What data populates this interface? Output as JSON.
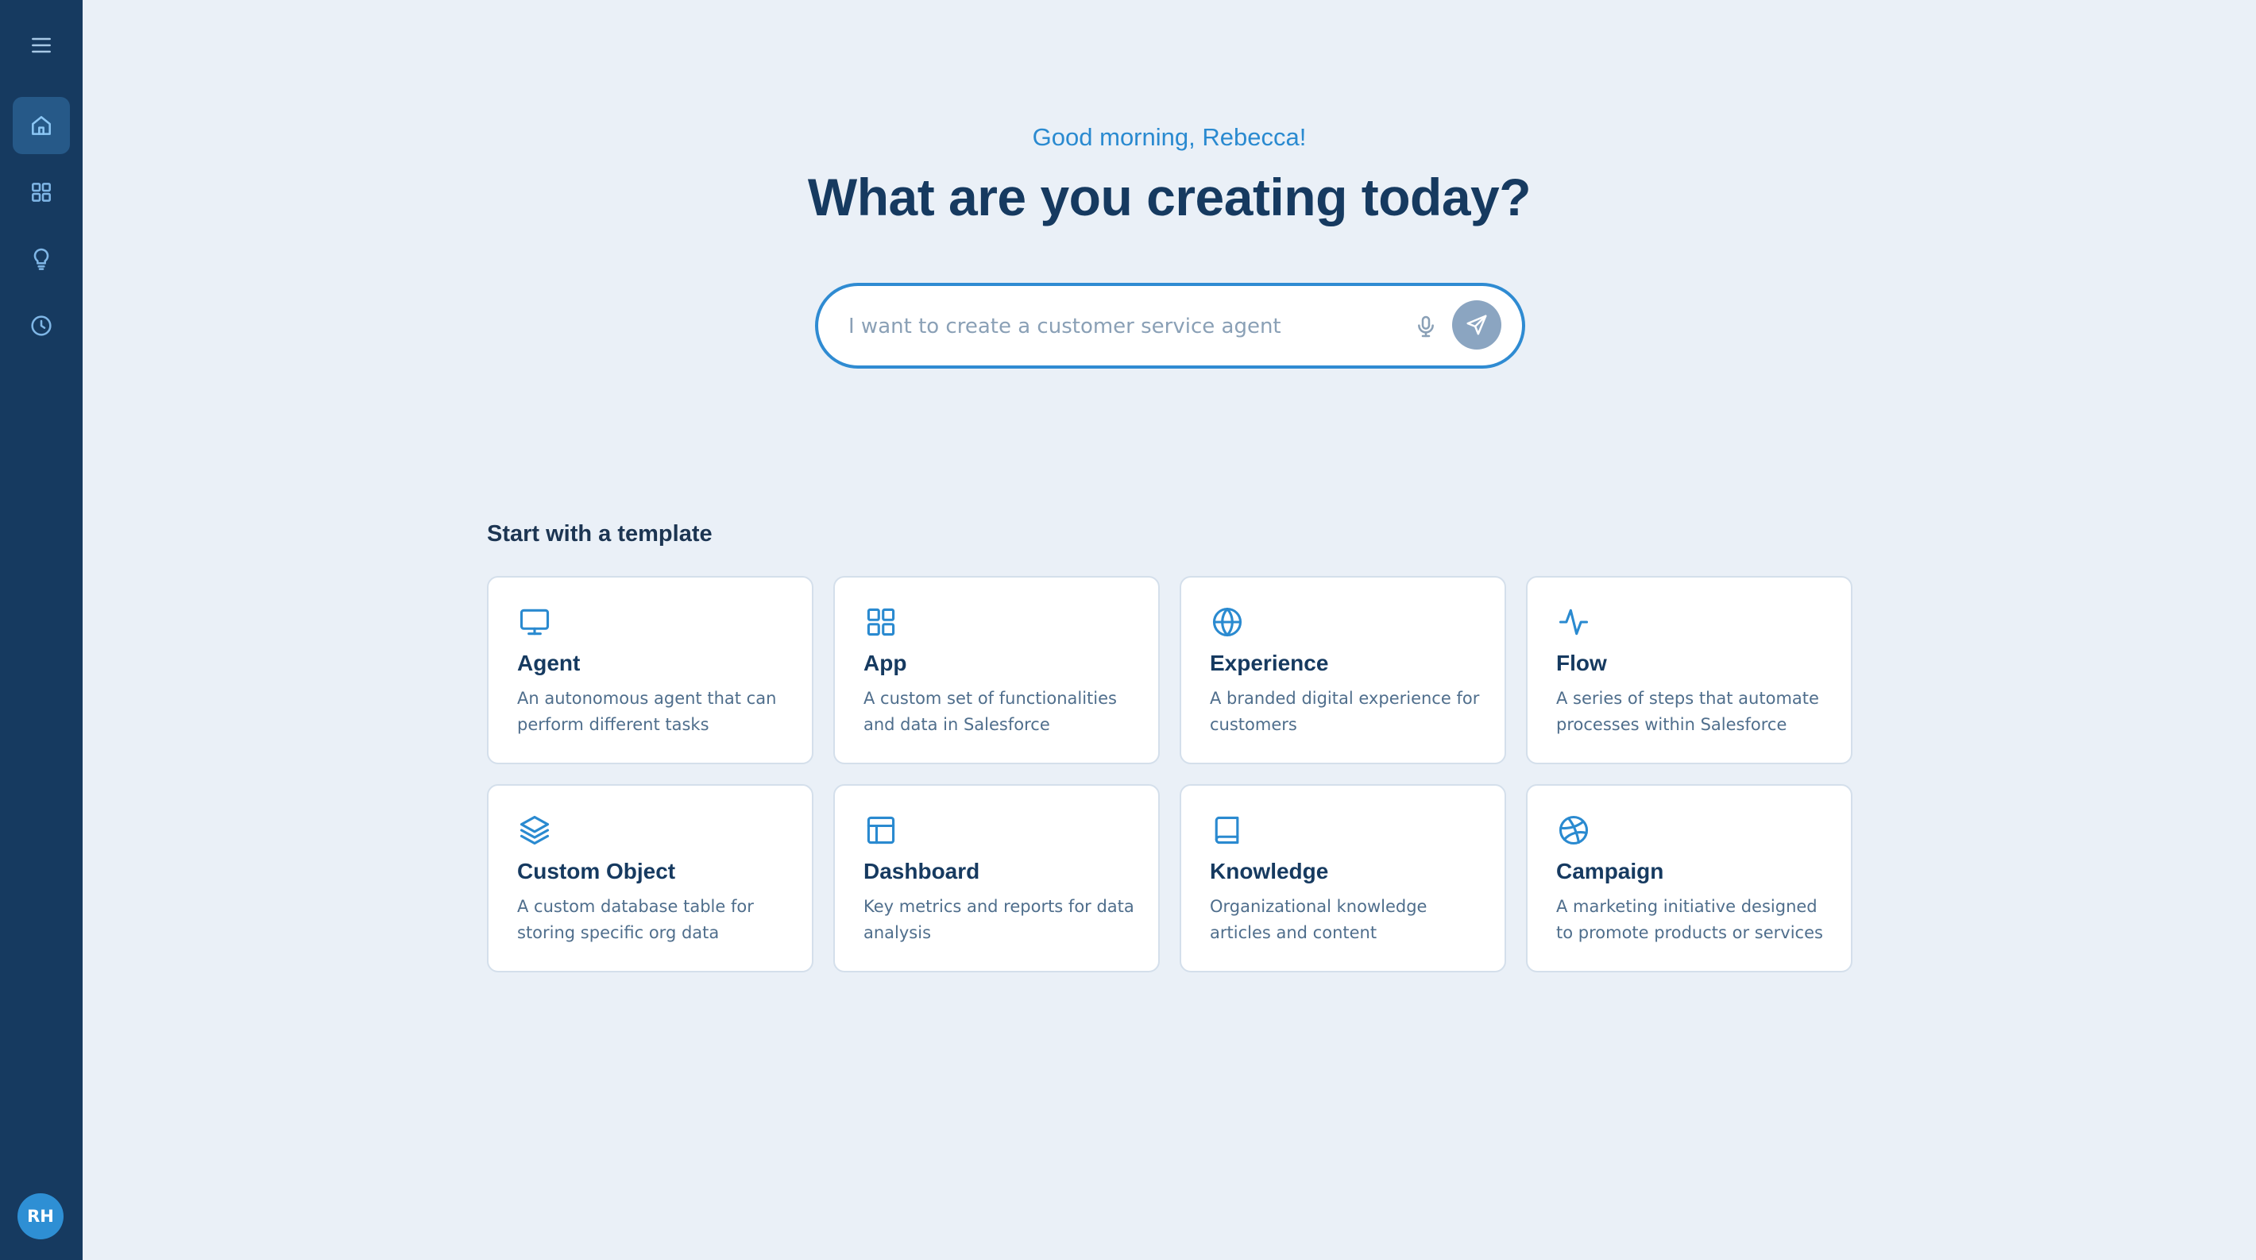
{
  "sidebar": {
    "items": [
      {
        "name": "menu",
        "icon": "hamburger-menu-icon"
      },
      {
        "name": "home",
        "icon": "home-icon",
        "active": true
      },
      {
        "name": "apps",
        "icon": "grid-icon"
      },
      {
        "name": "ideas",
        "icon": "lightbulb-icon"
      },
      {
        "name": "history",
        "icon": "clock-icon"
      }
    ],
    "avatar_initials": "RH"
  },
  "hero": {
    "greeting": "Good morning, Rebecca!",
    "headline": "What are you creating today?"
  },
  "search": {
    "placeholder": "I want to create a customer service agent",
    "value": "",
    "mic_icon": "microphone-icon",
    "send_icon": "send-icon"
  },
  "templates": {
    "title": "Start with a template",
    "items": [
      {
        "label": "Agent",
        "description": "An autonomous agent that can perform different tasks",
        "icon": "monitor-icon"
      },
      {
        "label": "App",
        "description": "A custom set of functionalities and data in Salesforce",
        "icon": "grid-icon"
      },
      {
        "label": "Experience",
        "description": "A branded digital experience for customers",
        "icon": "globe-icon"
      },
      {
        "label": "Flow",
        "description": "A series of steps that automate processes within Salesforce",
        "icon": "activity-icon"
      },
      {
        "label": "Custom Object",
        "description": "A custom database table for storing specific org data",
        "icon": "layers-icon"
      },
      {
        "label": "Dashboard",
        "description": "Key metrics and reports for data analysis",
        "icon": "layout-icon"
      },
      {
        "label": "Knowledge",
        "description": "Organizational knowledge articles and content",
        "icon": "book-icon"
      },
      {
        "label": "Campaign",
        "description": "A marketing initiative designed to promote products or services",
        "icon": "dribbble-icon"
      }
    ]
  },
  "colors": {
    "background": "#eaf0f7",
    "sidebar": "#163a60",
    "accent": "#2a8ad0",
    "headline": "#163a60"
  }
}
